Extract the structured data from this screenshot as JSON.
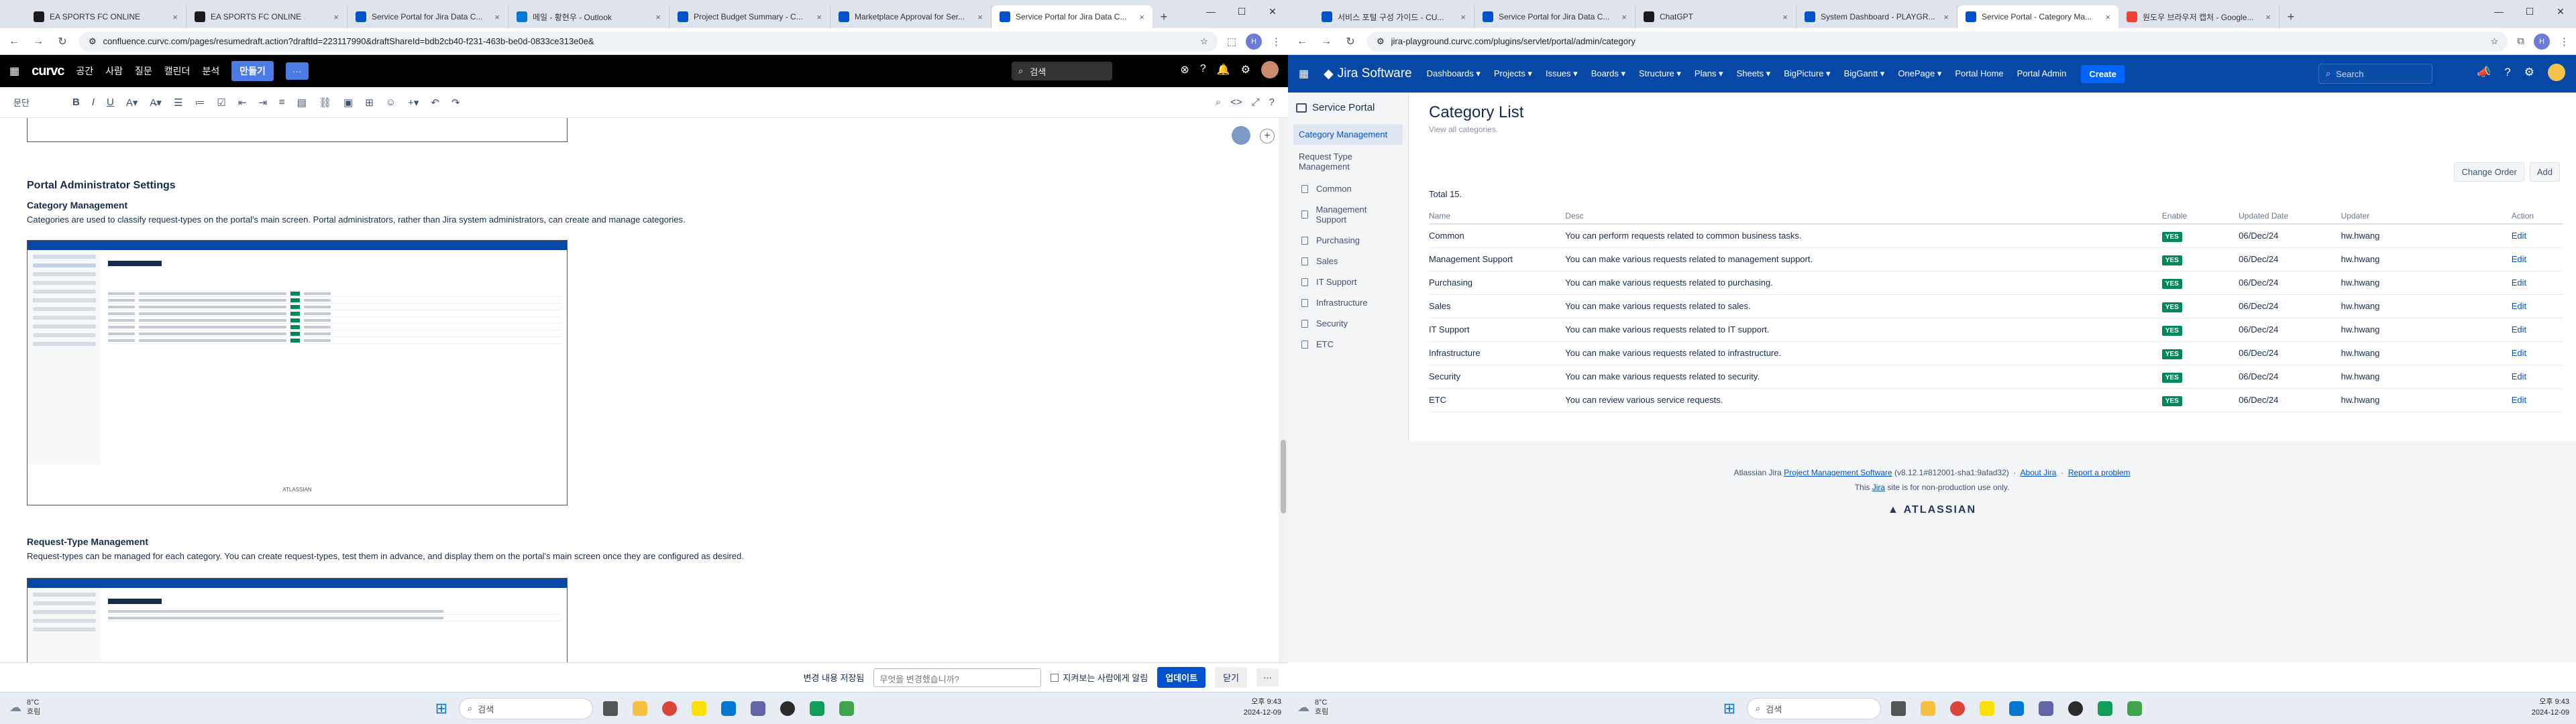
{
  "left": {
    "tabs": [
      {
        "title": "EA SPORTS FC ONLINE",
        "color": "#1b1b1b"
      },
      {
        "title": "EA SPORTS FC ONLINE",
        "color": "#1b1b1b"
      },
      {
        "title": "Service Portal for Jira Data C...",
        "color": "#0052cc"
      },
      {
        "title": "메일 - 황현우 - Outlook",
        "color": "#0078d4"
      },
      {
        "title": "Project Budget Summary - C...",
        "color": "#0052cc"
      },
      {
        "title": "Marketplace Approval for Ser...",
        "color": "#0052cc"
      },
      {
        "title": "Service Portal for Jira Data C...",
        "color": "#0052cc",
        "active": true
      }
    ],
    "url": "confluence.curvc.com/pages/resumedraft.action?draftId=223117990&draftShareId=bdb2cb40-f231-463b-be0d-0833ce313e0e&",
    "confluence": {
      "logo": "curvc",
      "nav": [
        "공간",
        "사람",
        "질문",
        "캘린더",
        "분석"
      ],
      "create": "만들기",
      "more": "···",
      "search_placeholder": "검색",
      "style_select": "문단"
    },
    "page": {
      "h_admin": "Portal Administrator Settings",
      "h_cat": "Category Management",
      "p_cat": "Categories are used to classify request-types on the portal's main screen. Portal administrators, rather than Jira system administrators, can create and manage categories.",
      "h_rt": "Request-Type Management",
      "p_rt": "Request-types can be managed for each category. You can create request-types, test them in advance, and display them on the portal's main screen once they are configured as desired.",
      "mini_footer": "ATLASSIAN"
    },
    "bottom": {
      "saved": "변경 내용 저장됨",
      "input_placeholder": "무엇을 변경했습니까?",
      "notify": "지켜보는 사람에게 알림",
      "update": "업데이트",
      "close": "닫기",
      "more": "···"
    },
    "taskbar": {
      "temp": "8°C",
      "weather": "흐림",
      "search": "검색",
      "time": "오후 9:43",
      "date": "2024-12-09"
    }
  },
  "right": {
    "tabs": [
      {
        "title": "서비스 포털 구성 가이드 - CU...",
        "color": "#0052cc"
      },
      {
        "title": "Service Portal for Jira Data C...",
        "color": "#0052cc"
      },
      {
        "title": "ChatGPT",
        "color": "#1b1b1b"
      },
      {
        "title": "System Dashboard - PLAYGR...",
        "color": "#0052cc"
      },
      {
        "title": "Service Portal - Category Ma...",
        "color": "#0052cc",
        "active": true
      },
      {
        "title": "원도우 브라우저 캡처 - Google...",
        "color": "#ea4335"
      }
    ],
    "url": "jira-playground.curvc.com/plugins/servlet/portal/admin/category",
    "jira": {
      "logo": "Jira Software",
      "nav": [
        "Dashboards ▾",
        "Projects ▾",
        "Issues ▾",
        "Boards ▾",
        "Structure ▾",
        "Plans ▾",
        "Sheets ▾",
        "BigPicture ▾",
        "BigGantt ▾",
        "OnePage ▾",
        "Portal Home",
        "Portal Admin"
      ],
      "create": "Create",
      "search_placeholder": "Search"
    },
    "sidebar": {
      "title": "Service Portal",
      "category_management": "Category Management",
      "request_type_management": "Request Type Management",
      "items": [
        "Common",
        "Management Support",
        "Purchasing",
        "Sales",
        "IT Support",
        "Infrastructure",
        "Security",
        "ETC"
      ]
    },
    "main": {
      "title": "Category List",
      "subtitle": "View all categories.",
      "change_order": "Change Order",
      "add": "Add",
      "total": "Total 15.",
      "columns": [
        "Name",
        "Desc",
        "Enable",
        "Updated Date",
        "Updater",
        "Action"
      ],
      "rows": [
        {
          "name": "Common",
          "desc": "You can perform requests related to common business tasks.",
          "enable": "YES",
          "date": "06/Dec/24",
          "updater": "hw.hwang",
          "action": "Edit"
        },
        {
          "name": "Management Support",
          "desc": "You can make various requests related to management support.",
          "enable": "YES",
          "date": "06/Dec/24",
          "updater": "hw.hwang",
          "action": "Edit"
        },
        {
          "name": "Purchasing",
          "desc": "You can make various requests related to purchasing.",
          "enable": "YES",
          "date": "06/Dec/24",
          "updater": "hw.hwang",
          "action": "Edit"
        },
        {
          "name": "Sales",
          "desc": "You can make various requests related to sales.",
          "enable": "YES",
          "date": "06/Dec/24",
          "updater": "hw.hwang",
          "action": "Edit"
        },
        {
          "name": "IT Support",
          "desc": "You can make various requests related to IT support.",
          "enable": "YES",
          "date": "06/Dec/24",
          "updater": "hw.hwang",
          "action": "Edit"
        },
        {
          "name": "Infrastructure",
          "desc": "You can make various requests related to infrastructure.",
          "enable": "YES",
          "date": "06/Dec/24",
          "updater": "hw.hwang",
          "action": "Edit"
        },
        {
          "name": "Security",
          "desc": "You can make various requests related to security.",
          "enable": "YES",
          "date": "06/Dec/24",
          "updater": "hw.hwang",
          "action": "Edit"
        },
        {
          "name": "ETC",
          "desc": "You can review various service requests.",
          "enable": "YES",
          "date": "06/Dec/24",
          "updater": "hw.hwang",
          "action": "Edit"
        }
      ]
    },
    "footer": {
      "prefix": "Atlassian Jira",
      "pm_link": "Project Management Software",
      "version": "(v8.12.1#812001-sha1:9afad32)",
      "about": "About Jira",
      "report": "Report a problem",
      "line2_pre": "This",
      "line2_link": "Jira",
      "line2_post": "site is for non-production use only.",
      "atlassian": "ATLASSIAN"
    },
    "taskbar": {
      "temp": "8°C",
      "weather": "흐림",
      "search": "검색",
      "time": "오후 9:43",
      "date": "2024-12-09"
    }
  }
}
